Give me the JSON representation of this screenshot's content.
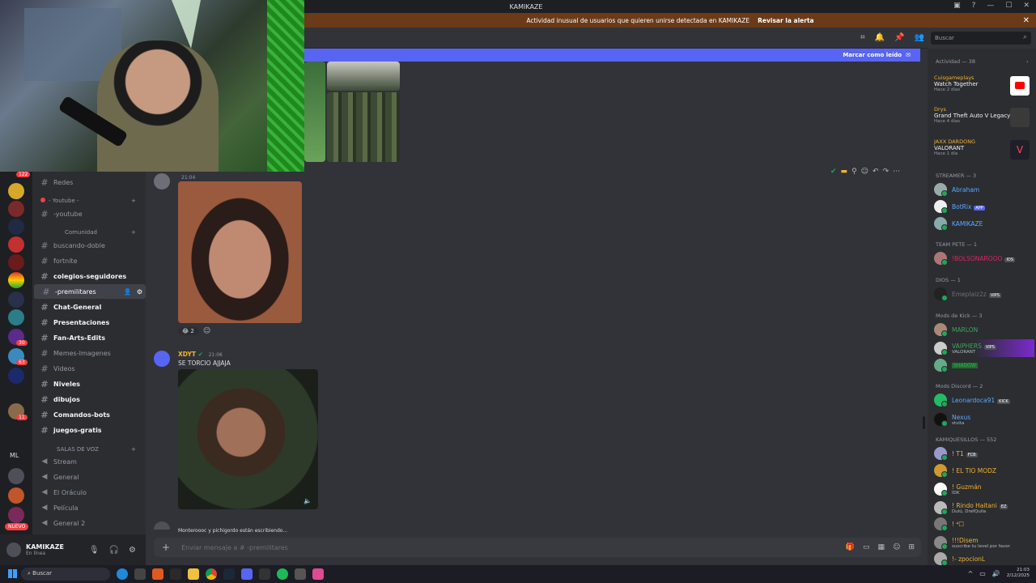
{
  "window": {
    "title": "KAMIKAZE"
  },
  "alert": {
    "text": "Actividad inusual de usuarios que quieren unirse detectada en KAMIKAZE",
    "action": "Revisar la alerta"
  },
  "new_messages": {
    "label": "Marcar como leído"
  },
  "search": {
    "placeholder": "Buscar"
  },
  "rail": {
    "badges": [
      "122",
      "30",
      "63",
      "11"
    ],
    "ml": "ML",
    "nuevo": "NUEVO"
  },
  "channels": {
    "items": [
      {
        "name": "Redes",
        "type": "text"
      },
      {
        "name": "-youtube",
        "type": "text"
      },
      {
        "name": "buscando-doble",
        "type": "text"
      },
      {
        "name": "fortnite",
        "type": "text"
      },
      {
        "name": "colegios-seguidores",
        "type": "text"
      },
      {
        "name": "-premilitares",
        "type": "text"
      },
      {
        "name": "Chat-General",
        "type": "text"
      },
      {
        "name": "Presentaciones",
        "type": "text"
      },
      {
        "name": "Fan-Arts-Edits",
        "type": "text"
      },
      {
        "name": "Memes-Imagenes",
        "type": "text"
      },
      {
        "name": "Videos",
        "type": "text"
      },
      {
        "name": "Niveles",
        "type": "text"
      },
      {
        "name": "dibujos",
        "type": "text"
      },
      {
        "name": "Comandos-bots",
        "type": "text"
      },
      {
        "name": "juegos-gratis",
        "type": "text"
      }
    ],
    "categories": [
      "- Youtube -",
      "Comunidad",
      "SALAS DE VOZ"
    ],
    "voice": [
      "Stream",
      "General",
      "El Oráculo",
      "Película",
      "General 2"
    ]
  },
  "user": {
    "name": "KAMIKAZE",
    "status": "En línea"
  },
  "messages": [
    {
      "author": "",
      "time": "21:04",
      "reactions": [
        "2"
      ]
    },
    {
      "author": "XDYT",
      "time": "21:06",
      "text": "SE TORCIO AJJAJA"
    }
  ],
  "typing": {
    "text": "Monteroooc y pichigordo están escribiendo..."
  },
  "composer": {
    "placeholder": "Enviar mensaje a # -premilitares"
  },
  "members": {
    "activity_header": "Actividad — 38",
    "activities": [
      {
        "user": "Cuisgameplays",
        "title": "Watch Together",
        "when": "Hace 2 días"
      },
      {
        "user": "Drys",
        "title": "Grand Theft Auto V Legacy",
        "when": "Hace 4 días"
      },
      {
        "user": "JAXX DARDONG",
        "title": "VALORANT",
        "when": "Hace 1 día"
      }
    ],
    "sections": [
      {
        "title": "STREAMER — 3",
        "members": [
          {
            "name": "Abraham"
          },
          {
            "name": "BotRix",
            "tag": "APP"
          },
          {
            "name": "KAMIKAZE"
          }
        ]
      },
      {
        "title": "TEAM PETE — 1",
        "members": [
          {
            "name": "!BOLSONAROOO",
            "tag": "IOS"
          }
        ]
      },
      {
        "title": "DIOS — 1",
        "members": [
          {
            "name": "Emeplaiz2z",
            "tag": "VIPS"
          }
        ]
      },
      {
        "title": "Mods de Kick — 3",
        "members": [
          {
            "name": "MARLON"
          },
          {
            "name": "VAIPHERS",
            "tag": "VIPS",
            "sub": "VALORANT"
          },
          {
            "name": "SHADOW"
          }
        ]
      },
      {
        "title": "Mods Discord — 2",
        "members": [
          {
            "name": "Leonardoca91",
            "tag": "KICK"
          },
          {
            "name": "Nexus",
            "sub": "stvita"
          }
        ]
      },
      {
        "title": "KAMIQUESILLOS — 552",
        "members": [
          {
            "name": "! T1",
            "tag": "FCB"
          },
          {
            "name": "! EL TIO MODZ"
          },
          {
            "name": "! Guzmán",
            "sub": "IDK"
          },
          {
            "name": "! Rindo Haitani",
            "tag": "EZ",
            "sub": "Dulú, DrefQuila"
          },
          {
            "name": "! ⁴☐"
          },
          {
            "name": "!!!Disem",
            "sub": "suscribe tu level por favor"
          },
          {
            "name": "!- zpocionL"
          }
        ]
      }
    ]
  },
  "taskbar": {
    "search": "Buscar",
    "time": "21:03",
    "date": "2/12/2025"
  }
}
